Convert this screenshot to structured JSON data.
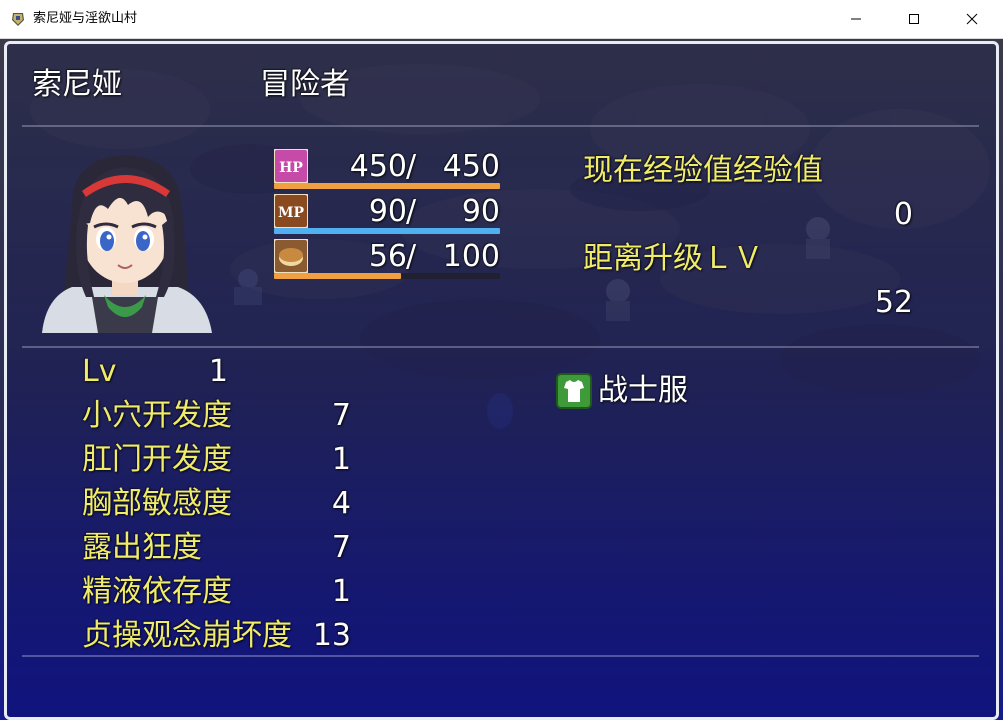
{
  "window": {
    "title": "索尼娅与淫欲山村",
    "app_icon": "game-app-icon",
    "controls": [
      "minimize-icon",
      "maximize-icon",
      "close-icon"
    ]
  },
  "actor": {
    "name": "索尼娅",
    "class": "冒险者",
    "portrait": "character-portrait"
  },
  "gauges": [
    {
      "icon": "hp-icon",
      "icon_text": "HP",
      "current": "450",
      "max": "450",
      "fill": 1.0,
      "color": "#f0a040"
    },
    {
      "icon": "mp-icon",
      "icon_text": "MP",
      "current": "90",
      "max": "90",
      "fill": 1.0,
      "color": "#50b0f0"
    },
    {
      "icon": "bread-icon",
      "icon_text": "",
      "current": "56",
      "max": "100",
      "fill": 0.56,
      "color": "#f0a040"
    }
  ],
  "exp": {
    "current_label": "现在经验值经验值",
    "current_value": "0",
    "next_label": "距离升级ＬＶ",
    "next_value": "52"
  },
  "stats": [
    {
      "label": "Lv",
      "value": "1"
    },
    {
      "label": "小穴开发度",
      "value": "7"
    },
    {
      "label": "肛门开发度",
      "value": "1"
    },
    {
      "label": "胸部敏感度",
      "value": "4"
    },
    {
      "label": "露出狂度",
      "value": "7"
    },
    {
      "label": "精液依存度",
      "value": "1"
    },
    {
      "label": "贞操观念崩坏度",
      "value": "13"
    }
  ],
  "equipment": {
    "icon": "armor-icon",
    "name": "战士服"
  },
  "colors": {
    "system_text": "#f0ec6a",
    "normal_text": "#ffffff",
    "hp_gauge": "#f0a040",
    "mp_gauge": "#50b0f0"
  }
}
